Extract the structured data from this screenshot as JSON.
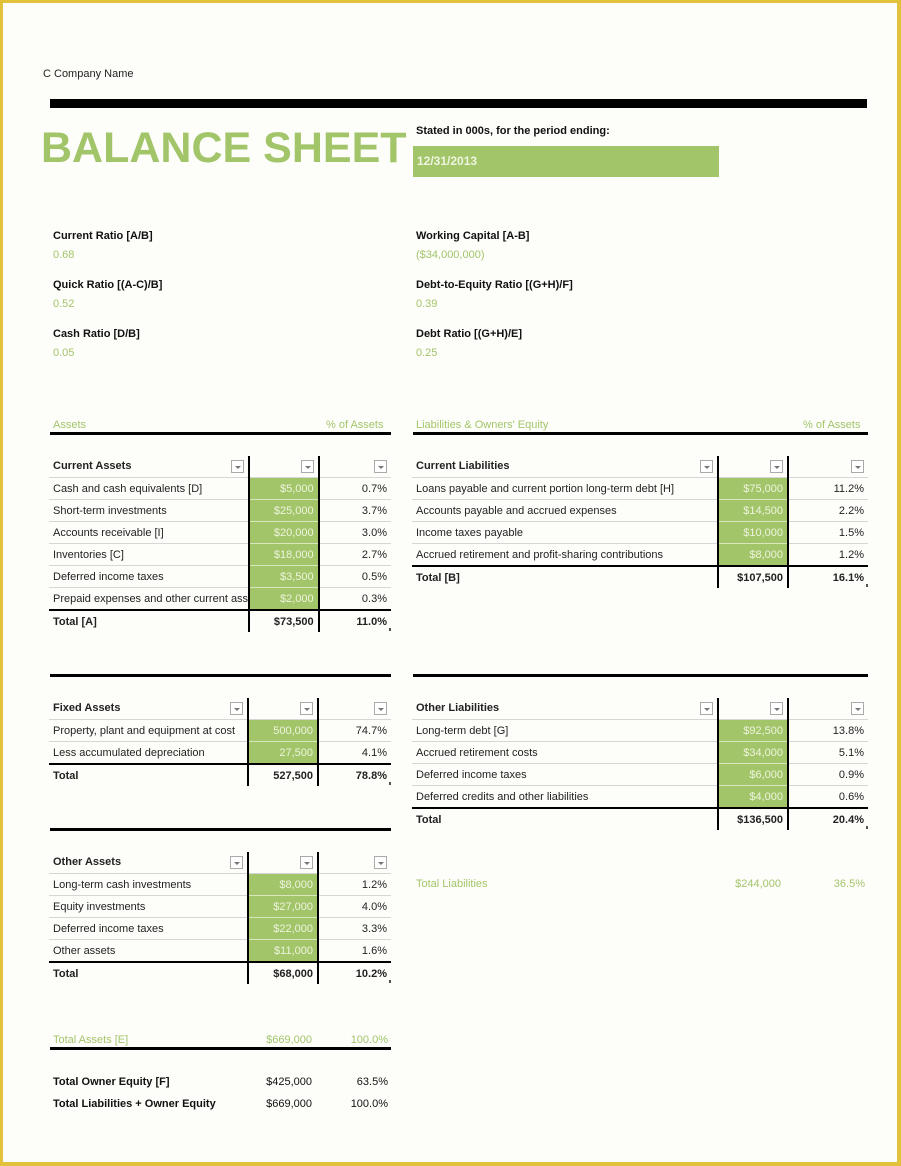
{
  "header": {
    "company": "C Company Name",
    "title": "BALANCE SHEET",
    "stated_label": "Stated in 000s, for the period ending:",
    "period_date": "12/31/2013"
  },
  "ratios": [
    {
      "label": "Current Ratio   [A/B]",
      "value": "0.68"
    },
    {
      "label": "Quick Ratio   [(A-C)/B]",
      "value": "0.52"
    },
    {
      "label": "Cash Ratio   [D/B]",
      "value": "0.05"
    },
    {
      "label": "Working Capital   [A-B]",
      "value": "($34,000,000)"
    },
    {
      "label": "Debt-to-Equity Ratio   [(G+H)/F]",
      "value": "0.39"
    },
    {
      "label": "Debt Ratio   [(G+H)/E]",
      "value": "0.25"
    }
  ],
  "assets_header": {
    "title": "Assets",
    "pct": "% of Assets"
  },
  "liab_header": {
    "title": "Liabilities & Owners' Equity",
    "pct": "% of Assets"
  },
  "current_assets": {
    "title": "Current Assets",
    "rows": [
      {
        "label": "Cash and cash equivalents   [D]",
        "value": "$5,000",
        "pct": "0.7%"
      },
      {
        "label": "Short-term investments",
        "value": "$25,000",
        "pct": "3.7%"
      },
      {
        "label": "Accounts receivable   [I]",
        "value": "$20,000",
        "pct": "3.0%"
      },
      {
        "label": "Inventories   [C]",
        "value": "$18,000",
        "pct": "2.7%"
      },
      {
        "label": "Deferred income taxes",
        "value": "$3,500",
        "pct": "0.5%"
      },
      {
        "label": "Prepaid expenses and other current assets",
        "value": "$2,000",
        "pct": "0.3%"
      }
    ],
    "total": {
      "label": "Total   [A]",
      "value": "$73,500",
      "pct": "11.0%"
    }
  },
  "current_liabilities": {
    "title": "Current Liabilities",
    "rows": [
      {
        "label": "Loans payable and current portion long-term debt   [H]",
        "value": "$75,000",
        "pct": "11.2%"
      },
      {
        "label": "Accounts payable and accrued expenses",
        "value": "$14,500",
        "pct": "2.2%"
      },
      {
        "label": "Income taxes payable",
        "value": "$10,000",
        "pct": "1.5%"
      },
      {
        "label": "Accrued retirement and profit-sharing contributions",
        "value": "$8,000",
        "pct": "1.2%"
      }
    ],
    "total": {
      "label": "Total   [B]",
      "value": "$107,500",
      "pct": "16.1%"
    }
  },
  "fixed_assets": {
    "title": "Fixed Assets",
    "rows": [
      {
        "label": "Property, plant and equipment at cost",
        "value": "500,000",
        "pct": "74.7%"
      },
      {
        "label": "Less accumulated depreciation",
        "value": "27,500",
        "pct": "4.1%"
      }
    ],
    "total": {
      "label": "Total",
      "value": "527,500",
      "pct": "78.8%"
    }
  },
  "other_liabilities": {
    "title": "Other Liabilities",
    "rows": [
      {
        "label": "Long-term debt   [G]",
        "value": "$92,500",
        "pct": "13.8%"
      },
      {
        "label": "Accrued retirement costs",
        "value": "$34,000",
        "pct": "5.1%"
      },
      {
        "label": "Deferred income taxes",
        "value": "$6,000",
        "pct": "0.9%"
      },
      {
        "label": "Deferred credits and other liabilities",
        "value": "$4,000",
        "pct": "0.6%"
      }
    ],
    "total": {
      "label": "Total",
      "value": "$136,500",
      "pct": "20.4%"
    }
  },
  "other_assets": {
    "title": "Other Assets",
    "rows": [
      {
        "label": "Long-term cash investments",
        "value": "$8,000",
        "pct": "1.2%"
      },
      {
        "label": "Equity investments",
        "value": "$27,000",
        "pct": "4.0%"
      },
      {
        "label": "Deferred income taxes",
        "value": "$22,000",
        "pct": "3.3%"
      },
      {
        "label": "Other assets",
        "value": "$11,000",
        "pct": "1.6%"
      }
    ],
    "total": {
      "label": "Total",
      "value": "$68,000",
      "pct": "10.2%"
    }
  },
  "total_liabilities": {
    "label": "Total Liabilities",
    "value": "$244,000",
    "pct": "36.5%"
  },
  "total_assets": {
    "label": "Total Assets   [E]",
    "value": "$669,000",
    "pct": "100.0%"
  },
  "total_owner_equity": {
    "label": "Total Owner Equity   [F]",
    "value": "$425,000",
    "pct": "63.5%"
  },
  "total_liab_equity": {
    "label": "Total Liabilities + Owner Equity",
    "value": "$669,000",
    "pct": "100.0%"
  },
  "colors": {
    "accent": "#a3c56a",
    "frame": "#e2c23a",
    "rule": "#000000"
  }
}
